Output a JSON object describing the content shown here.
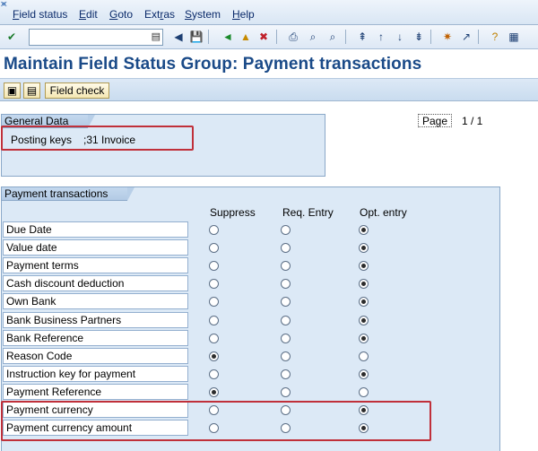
{
  "menubar": {
    "items": [
      {
        "label": "Field status",
        "ul": "F"
      },
      {
        "label": "Edit",
        "ul": "E"
      },
      {
        "label": "Goto",
        "ul": "G"
      },
      {
        "label": "Extras",
        "ul": "r"
      },
      {
        "label": "System",
        "ul": "S"
      },
      {
        "label": "Help",
        "ul": "H"
      }
    ]
  },
  "toolbar": {
    "command_value": "",
    "icons": [
      "enter-icon",
      "save-icon",
      "back-icon",
      "exit-icon",
      "cancel-icon",
      "print-icon",
      "find-icon",
      "find-next-icon",
      "first-page-icon",
      "previous-page-icon",
      "next-page-icon",
      "last-page-icon",
      "create-session-icon",
      "shortcut-icon",
      "help-icon",
      "layout-icon"
    ]
  },
  "title": "Maintain Field Status Group: Payment transactions",
  "apptoolbar": {
    "field_check_label": "Field check"
  },
  "general": {
    "tab": "General Data",
    "posting_label": "Posting keys",
    "posting_value": ";31  Invoice",
    "page_label": "Page",
    "page_value": "1  /  1"
  },
  "payment": {
    "tab": "Payment transactions",
    "columns": [
      "Suppress",
      "Req. Entry",
      "Opt. entry"
    ],
    "rows": [
      {
        "label": "Due Date",
        "selected": 2
      },
      {
        "label": "Value date",
        "selected": 2
      },
      {
        "label": "Payment terms",
        "selected": 2
      },
      {
        "label": "Cash discount deduction",
        "selected": 2
      },
      {
        "label": "Own Bank",
        "selected": 2
      },
      {
        "label": "Bank Business Partners",
        "selected": 2
      },
      {
        "label": "Bank Reference",
        "selected": 2
      },
      {
        "label": "Reason Code",
        "selected": 0
      },
      {
        "label": "Instruction key for payment",
        "selected": 2
      },
      {
        "label": "Payment Reference",
        "selected": 0
      },
      {
        "label": "Payment currency",
        "selected": 2
      },
      {
        "label": "Payment currency amount",
        "selected": 2
      }
    ]
  },
  "colors": {
    "title": "#1a4a88",
    "highlight": "#c0303a",
    "group_bg": "#dce9f6"
  }
}
